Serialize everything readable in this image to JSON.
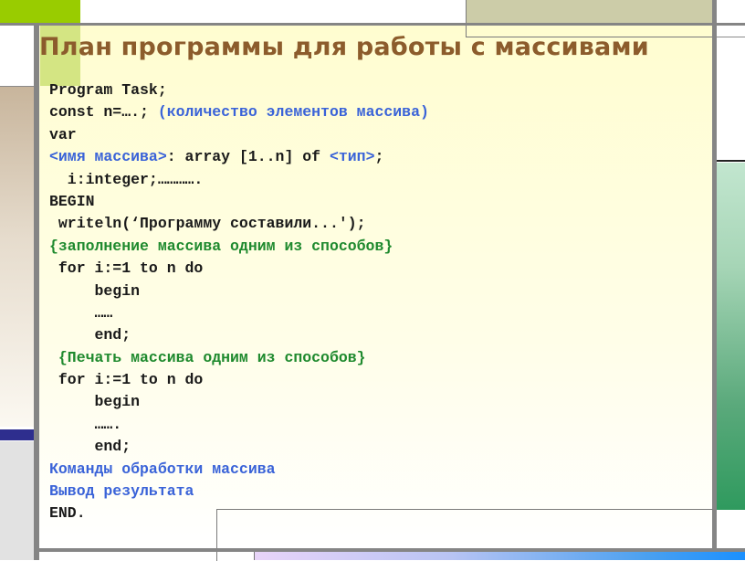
{
  "slide": {
    "title": "План программы для работы с массивами",
    "colors": {
      "title": "#8c5c2c",
      "code": "#1a1a1a",
      "placeholder_blue": "#3a63d8",
      "comment_green": "#1f8a2e",
      "accent_lime": "#99cc00",
      "accent_green": "#2f9a5e",
      "frame_gray": "#858585"
    },
    "code_lines": [
      {
        "parts": [
          {
            "text": "Program Task;",
            "style": "code"
          }
        ]
      },
      {
        "parts": [
          {
            "text": "const n=….; ",
            "style": "code"
          },
          {
            "text": "(количество элементов массива)",
            "style": "blue"
          }
        ]
      },
      {
        "parts": [
          {
            "text": "var",
            "style": "code"
          }
        ]
      },
      {
        "parts": [
          {
            "text": "<имя массива>",
            "style": "blue"
          },
          {
            "text": ": array [1..n] of ",
            "style": "code"
          },
          {
            "text": "<тип>",
            "style": "blue"
          },
          {
            "text": ";",
            "style": "code"
          }
        ]
      },
      {
        "parts": [
          {
            "text": "  i:integer;………….",
            "style": "code"
          }
        ]
      },
      {
        "parts": [
          {
            "text": "BEGIN",
            "style": "code"
          }
        ]
      },
      {
        "parts": [
          {
            "text": " writeln(‘Программу составили...');",
            "style": "code"
          }
        ]
      },
      {
        "parts": [
          {
            "text": "{заполнение массива одним из способов}",
            "style": "green"
          }
        ]
      },
      {
        "parts": [
          {
            "text": " for i:=1 to n do",
            "style": "code"
          }
        ]
      },
      {
        "parts": [
          {
            "text": "     begin",
            "style": "code"
          }
        ]
      },
      {
        "parts": [
          {
            "text": "     ……",
            "style": "code"
          }
        ]
      },
      {
        "parts": [
          {
            "text": "     end;",
            "style": "code"
          }
        ]
      },
      {
        "parts": [
          {
            "text": " {Печать массива одним из способов}",
            "style": "green"
          }
        ]
      },
      {
        "parts": [
          {
            "text": " for i:=1 to n do",
            "style": "code"
          }
        ]
      },
      {
        "parts": [
          {
            "text": "     begin",
            "style": "code"
          }
        ]
      },
      {
        "parts": [
          {
            "text": "     …….",
            "style": "code"
          }
        ]
      },
      {
        "parts": [
          {
            "text": "     end;",
            "style": "code"
          }
        ]
      },
      {
        "parts": [
          {
            "text": "Команды обработки массива",
            "style": "blue"
          }
        ]
      },
      {
        "parts": [
          {
            "text": "Вывод результата",
            "style": "blue"
          }
        ]
      },
      {
        "parts": [
          {
            "text": "END.",
            "style": "code"
          }
        ]
      }
    ]
  }
}
